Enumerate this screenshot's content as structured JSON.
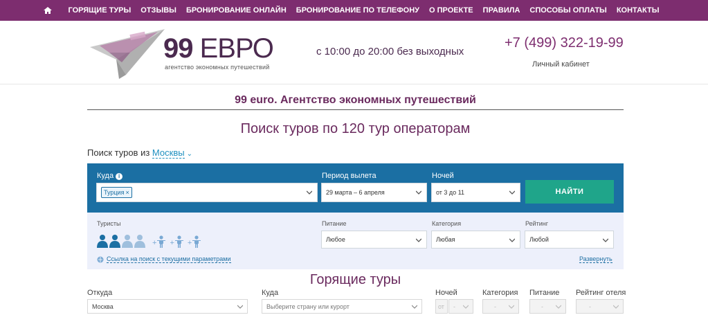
{
  "nav": {
    "items": [
      "ГОРЯЩИЕ ТУРЫ",
      "ОТЗЫВЫ",
      "БРОНИРОВАНИЕ ОНЛАЙН",
      "БРОНИРОВАНИЕ ПО ТЕЛЕФОНУ",
      "О ПРОЕКТЕ",
      "ПРАВИЛА",
      "СПОСОБЫ ОПЛАТЫ",
      "КОНТАКТЫ"
    ]
  },
  "header": {
    "logo_number": "99",
    "logo_word": "ЕВРО",
    "logo_tagline": "агентство экономных путешествий",
    "hours": "с 10:00 до 20:00 без выходных",
    "phone": "+7 (499) 322-19-99",
    "cabinet_link": "Личный кабинет"
  },
  "main": {
    "agency_title": "99 euro. Агентство экономных путешествий",
    "search_heading": "Поиск туров по 120 тур операторам",
    "from_label": "Поиск туров из",
    "from_city": "Москвы"
  },
  "search": {
    "where_label": "Куда",
    "where_tag": "Турция",
    "period_label": "Период вылета",
    "period_value": "29 марта – 6 апреля",
    "nights_label": "Ночей",
    "nights_value": "от 3 до 11",
    "find_button": "НАЙТИ",
    "tourists_label": "Туристы",
    "meal_label": "Питание",
    "meal_value": "Любое",
    "category_label": "Категория",
    "category_value": "Любая",
    "rating_label": "Рейтинг",
    "rating_value": "Любой",
    "link_text": "Ссылка на поиск с текущими параметрами",
    "expand_text": "Развернуть",
    "adults_selected": 2,
    "adults_total": 4,
    "children_slots": 3
  },
  "hot": {
    "heading": "Горящие туры",
    "from_label": "Откуда",
    "from_value": "Москва",
    "to_label": "Куда",
    "to_placeholder": "Выберите страну или курорт",
    "nights_label": "Ночей",
    "nights_from": "от",
    "nights_dash": "-",
    "category_label": "Категория",
    "category_value": "-",
    "meal_label": "Питание",
    "meal_value": "-",
    "rating_label": "Рейтинг отеля",
    "rating_value": "-"
  },
  "colors": {
    "nav_bg": "#7d2d6f",
    "panel_blue": "#1b6fa3",
    "button_green": "#1fa58a",
    "heading_purple": "#6a2a5e"
  }
}
